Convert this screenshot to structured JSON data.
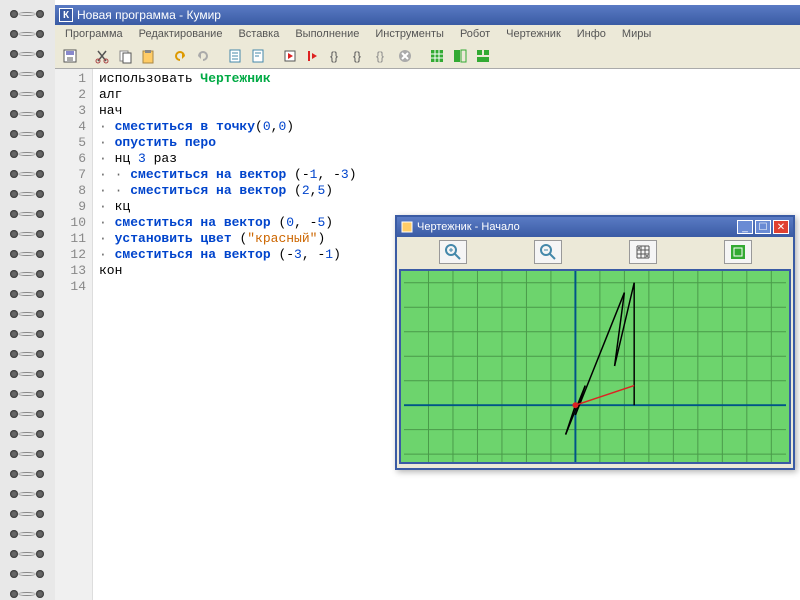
{
  "titlebar": {
    "icon_letter": "К",
    "title": "Новая программа - Кумир"
  },
  "menu": [
    "Программа",
    "Редактирование",
    "Вставка",
    "Выполнение",
    "Инструменты",
    "Робот",
    "Чертежник",
    "Инфо",
    "Миры"
  ],
  "code_lines": [
    {
      "n": 1,
      "tokens": [
        [
          "",
          "использовать "
        ],
        [
          "green",
          "Чертежник"
        ]
      ]
    },
    {
      "n": 2,
      "tokens": [
        [
          "",
          "алг"
        ]
      ]
    },
    {
      "n": 3,
      "tokens": [
        [
          "",
          "нач"
        ]
      ]
    },
    {
      "n": 4,
      "tokens": [
        [
          "bullet",
          "· "
        ],
        [
          "blue",
          "сместиться в точку"
        ],
        [
          "",
          "("
        ],
        [
          "num",
          "0"
        ],
        [
          "",
          ","
        ],
        [
          "num",
          "0"
        ],
        [
          "",
          ")"
        ]
      ]
    },
    {
      "n": 5,
      "tokens": [
        [
          "bullet",
          "· "
        ],
        [
          "blue",
          "опустить перо"
        ]
      ]
    },
    {
      "n": 6,
      "tokens": [
        [
          "bullet",
          "· "
        ],
        [
          "",
          "нц "
        ],
        [
          "num",
          "3"
        ],
        [
          "",
          " раз"
        ]
      ]
    },
    {
      "n": 7,
      "tokens": [
        [
          "bullet",
          "· · "
        ],
        [
          "blue",
          "сместиться на вектор"
        ],
        [
          "",
          " (-"
        ],
        [
          "num",
          "1"
        ],
        [
          "",
          ", -"
        ],
        [
          "num",
          "3"
        ],
        [
          "",
          ")"
        ]
      ]
    },
    {
      "n": 8,
      "tokens": [
        [
          "bullet",
          "· · "
        ],
        [
          "blue",
          "сместиться на вектор"
        ],
        [
          "",
          " ("
        ],
        [
          "num",
          "2"
        ],
        [
          "",
          ","
        ],
        [
          "num",
          "5"
        ],
        [
          "",
          ")"
        ]
      ]
    },
    {
      "n": 9,
      "tokens": [
        [
          "bullet",
          "· "
        ],
        [
          "",
          "кц"
        ]
      ]
    },
    {
      "n": 10,
      "tokens": [
        [
          "bullet",
          "· "
        ],
        [
          "blue",
          "сместиться на вектор"
        ],
        [
          "",
          " ("
        ],
        [
          "num",
          "0"
        ],
        [
          "",
          ", -"
        ],
        [
          "num",
          "5"
        ],
        [
          "",
          ")"
        ]
      ]
    },
    {
      "n": 11,
      "tokens": [
        [
          "bullet",
          "· "
        ],
        [
          "blue",
          "установить цвет"
        ],
        [
          "",
          " ("
        ],
        [
          "str",
          "\"красный\""
        ],
        [
          "",
          ")"
        ]
      ]
    },
    {
      "n": 12,
      "tokens": [
        [
          "bullet",
          "· "
        ],
        [
          "blue",
          "сместиться на вектор"
        ],
        [
          "",
          " (-"
        ],
        [
          "num",
          "3"
        ],
        [
          "",
          ", -"
        ],
        [
          "num",
          "1"
        ],
        [
          "",
          ")"
        ]
      ]
    },
    {
      "n": 13,
      "tokens": [
        [
          "",
          "кон"
        ]
      ]
    },
    {
      "n": 14,
      "tokens": []
    }
  ],
  "draw": {
    "title": "Чертежник - Начало",
    "toolbar_icons": [
      "zoom-in-icon",
      "zoom-out-icon",
      "grid-icon",
      "fit-icon"
    ]
  }
}
